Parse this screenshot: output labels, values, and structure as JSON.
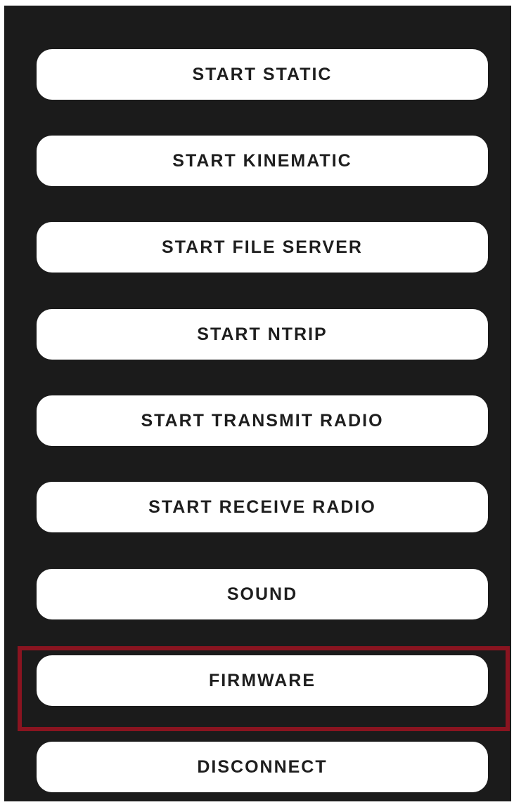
{
  "menu": {
    "buttons": [
      {
        "id": "start-static",
        "label": "START STATIC"
      },
      {
        "id": "start-kinematic",
        "label": "START KINEMATIC"
      },
      {
        "id": "start-file-server",
        "label": "START FILE SERVER"
      },
      {
        "id": "start-ntrip",
        "label": "START NTRIP"
      },
      {
        "id": "start-transmit-radio",
        "label": "START TRANSMIT RADIO"
      },
      {
        "id": "start-receive-radio",
        "label": "START RECEIVE RADIO"
      },
      {
        "id": "sound",
        "label": "SOUND"
      },
      {
        "id": "firmware",
        "label": "FIRMWARE",
        "highlighted": true
      },
      {
        "id": "disconnect",
        "label": "DISCONNECT"
      }
    ]
  },
  "colors": {
    "background": "#1b1b1b",
    "button_fill": "#ffffff",
    "button_text": "#1e1e1e",
    "highlight_border": "#8a1420"
  }
}
